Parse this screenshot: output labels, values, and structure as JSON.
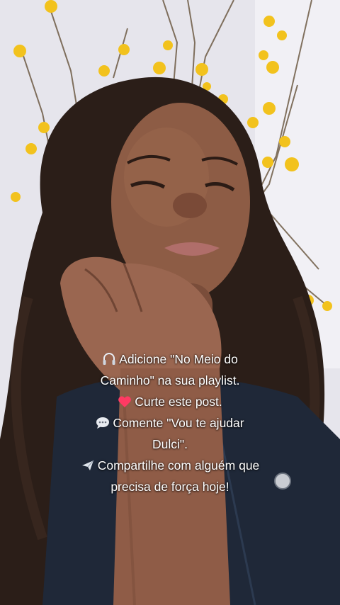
{
  "colors": {
    "wall": "#e9e8ee",
    "flowers": "#f2c21d",
    "branch": "#6b5a45",
    "skin": "#8a5a44",
    "hair": "#2a1d18",
    "jacket": "#1f2a3a",
    "caption_text": "#ffffff",
    "heart": "#ff3a63"
  },
  "caption": {
    "lines": [
      {
        "icon": "headphones-icon",
        "text": "Adicione \"No Meio do"
      },
      {
        "icon": "",
        "text": "Caminho\" na sua playlist."
      },
      {
        "icon": "heart-icon",
        "text": "Curte este post."
      },
      {
        "icon": "speech-bubble-icon",
        "text": "Comente \"Vou te ajudar"
      },
      {
        "icon": "",
        "text": "Dulci\"."
      },
      {
        "icon": "airplane-icon",
        "text": "Compartilhe com alguém que"
      },
      {
        "icon": "",
        "text": "precisa de força hoje!"
      }
    ]
  }
}
